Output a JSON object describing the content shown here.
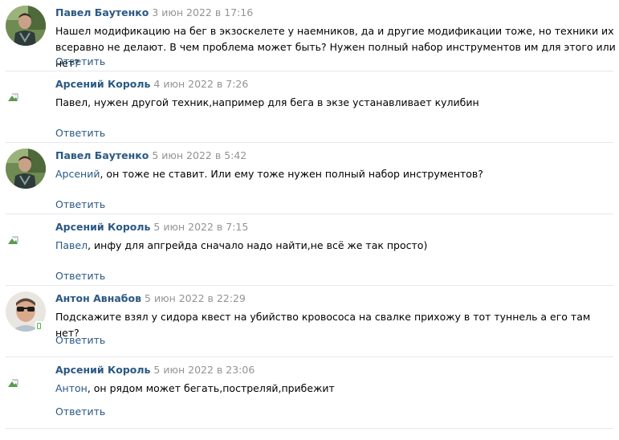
{
  "reply_label": "Ответить",
  "comments": [
    {
      "author": "Павел Баутенко",
      "date": "3 июн 2022 в 17:16",
      "mention": "",
      "text": "Нашел модификацию на бег в экзоскелете у наемников, да и другие модификации тоже, но техники их всеравно не делают. В чем проблема может быть? Нужен полный набор инструментов им для этого или нет?",
      "avatar": "photo"
    },
    {
      "author": "Арсений Король",
      "date": "4 июн 2022 в 7:26",
      "mention": "",
      "text": "Павел, нужен другой техник,например для бега в экзе устанавливает кулибин",
      "avatar": "broken-image"
    },
    {
      "author": "Павел Баутенко",
      "date": "5 июн 2022 в 5:42",
      "mention": "Арсений",
      "text": ", он тоже не ставит. Или ему тоже нужен полный набор инструментов?",
      "avatar": "photo"
    },
    {
      "author": "Арсений Король",
      "date": "5 июн 2022 в 7:15",
      "mention": "Павел",
      "text": ", инфу для апгрейда сначало надо найти,не всё же так просто)",
      "avatar": "broken-image"
    },
    {
      "author": "Антон Авнабов",
      "date": "5 июн 2022 в 22:29",
      "mention": "",
      "text": "Подскажите взял у сидора квест на убийство кровососа на свалке прихожу в тот туннель а его там нет?",
      "avatar": "photo-sunglasses",
      "online_mobile": true
    },
    {
      "author": "Арсений Король",
      "date": "5 июн 2022 в 23:06",
      "mention": "Антон",
      "text": ", он рядом может бегать,постреляй,прибежит",
      "avatar": "broken-image"
    }
  ]
}
